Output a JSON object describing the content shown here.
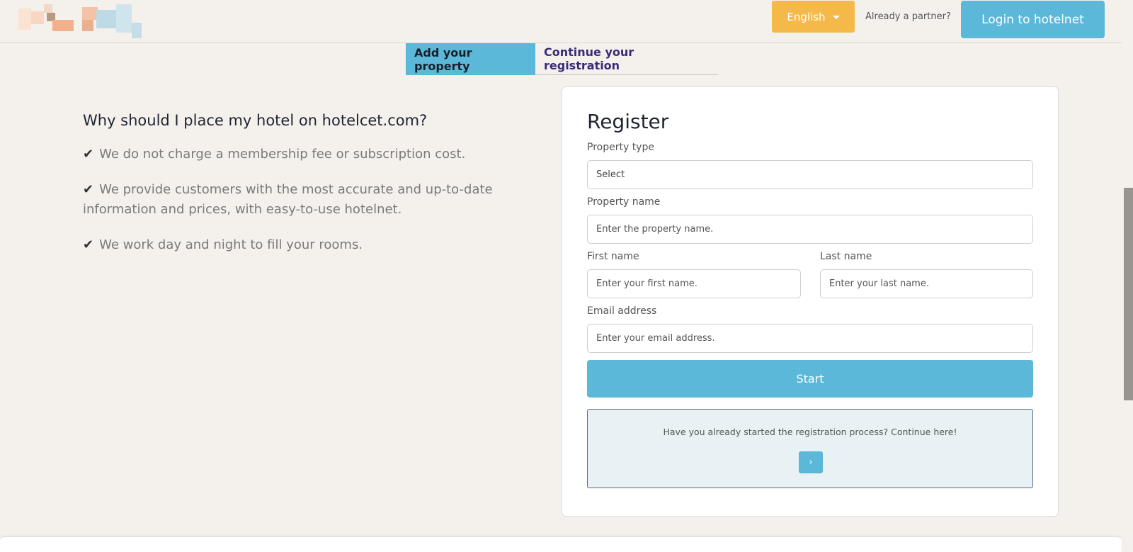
{
  "header": {
    "language": "English",
    "partner_prompt": "Already a partner?",
    "login_label": "Login to hotelnet"
  },
  "tabs": [
    {
      "label": "Add your property",
      "active": true
    },
    {
      "label": "Continue your registration",
      "active": false
    }
  ],
  "benefits": {
    "heading": "Why should I place my hotel on hotelcet.com?",
    "check_glyph": "✔",
    "items": [
      "We do not charge a membership fee or subscription cost.",
      "We provide customers with the most accurate and up-to-date information and prices, with easy-to-use hotelnet.",
      "We work day and night to fill your rooms."
    ]
  },
  "register": {
    "title": "Register",
    "property_type": {
      "label": "Property type",
      "value": "Select"
    },
    "property_name": {
      "label": "Property name",
      "placeholder": "Enter the property name."
    },
    "first_name": {
      "label": "First name",
      "placeholder": "Enter your first name."
    },
    "last_name": {
      "label": "Last name",
      "placeholder": "Enter your last name."
    },
    "email": {
      "label": "Email address",
      "placeholder": "Enter your email address."
    },
    "start_label": "Start",
    "continue_text": "Have you already started the registration process? Continue here!",
    "arrow_glyph": "›"
  },
  "colors": {
    "accent_blue": "#5bb8d9",
    "language_orange": "#f5b94a",
    "tab_text_purple": "#3a2a7a",
    "page_background": "#f4f1ed"
  }
}
